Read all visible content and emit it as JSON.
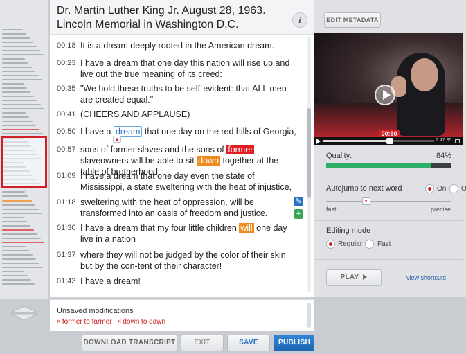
{
  "transcript": {
    "title": "Dr. Martin Luther King Jr.  August 28, 1963. Lincoln Memorial in Washington D.C.",
    "rows": [
      {
        "time": "00:18",
        "segments": [
          {
            "text": "It is a dream deeply rooted in the American dream."
          }
        ]
      },
      {
        "time": "00:23",
        "segments": [
          {
            "text": "I have a dream that one day this nation will rise up and live out the true meaning of its creed:"
          }
        ]
      },
      {
        "time": "00:35",
        "segments": [
          {
            "text": " \"We hold these truths to be self-evident: that ALL men are created equal.\""
          }
        ]
      },
      {
        "time": "00:41",
        "segments": [
          {
            "text": " (CHEERS AND APPLAUSE)"
          }
        ]
      },
      {
        "time": "00:50",
        "segments": [
          {
            "text": "I have a "
          },
          {
            "text": "dream",
            "style": "blue"
          },
          {
            "text": " that one day on the red hills of Georgia,"
          }
        ]
      },
      {
        "time": "00:57",
        "segments": [
          {
            "text": "sons of former slaves and the sons of "
          },
          {
            "text": "former",
            "style": "red"
          },
          {
            "text": " slaveowners will be able to sit "
          },
          {
            "text": "down",
            "style": "orange"
          },
          {
            "text": " together at the table of brotherhood."
          }
        ]
      },
      {
        "time": "01:09",
        "segments": [
          {
            "text": "I have a dream that one day even the state of Mississippi, a state sweltering with the heat of injustice,"
          }
        ]
      },
      {
        "time": "01:18",
        "segments": [
          {
            "text": "sweltering with the heat of oppression, will be transformed into an oasis of freedom and justice."
          }
        ]
      },
      {
        "time": "01:30",
        "segments": [
          {
            "text": "I have a dream that my four little children "
          },
          {
            "text": "will",
            "style": "orange"
          },
          {
            "text": " one day live in a nation"
          }
        ]
      },
      {
        "time": "01:37",
        "segments": [
          {
            "text": "where they will not be judged by the color of their skin but by the con-tent of their character!"
          }
        ]
      },
      {
        "time": "01:43",
        "segments": [
          {
            "text": "I have a dream!"
          }
        ]
      }
    ]
  },
  "unsaved": {
    "title": "Unsaved modifications",
    "items": [
      "former to farmer",
      "down to dawn"
    ]
  },
  "buttons": {
    "download": "DOWNLOAD TRANSCRIPT",
    "exit": "EXIT",
    "save": "SAVE",
    "publish": "PUBLISH",
    "edit_metadata": "EDIT METADATA",
    "play": "PLAY"
  },
  "player": {
    "current_time": "00:50",
    "duration": "7:47:35",
    "progress_fraction": 0.6
  },
  "quality": {
    "label": "Quality:",
    "value": "84%",
    "fraction": 0.84
  },
  "autojump": {
    "label": "Autojump to next word",
    "on_label": "On",
    "off_label": "Off",
    "selected": "On",
    "slider_fast": "fast",
    "slider_precise": "precise",
    "slider_fraction": 0.32
  },
  "editing_mode": {
    "label": "Editing mode",
    "regular_label": "Regular",
    "fast_label": "Fast",
    "selected": "Regular"
  },
  "links": {
    "shortcuts": "view shortcuts"
  },
  "colors": {
    "accent_blue": "#2a72c4",
    "accent_red": "#d21f26",
    "highlight_orange": "#f08a1c",
    "quality_green": "#2fae6a"
  },
  "icons": [
    "info-icon",
    "pencil-icon",
    "plus-icon",
    "play-icon",
    "chevron-down-icon",
    "caret-up-icon"
  ]
}
